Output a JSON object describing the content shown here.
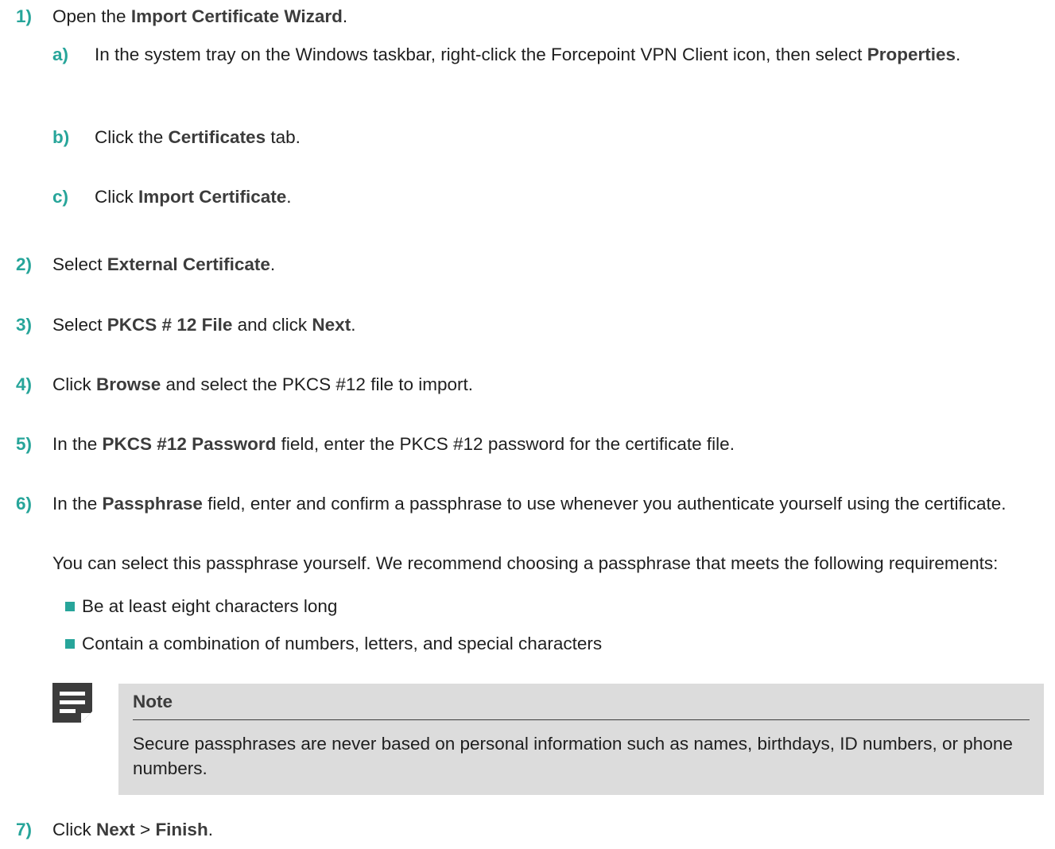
{
  "steps": [
    {
      "num": "1)",
      "parts": [
        "Open the ",
        "Import Certificate Wizard",
        "."
      ]
    },
    {
      "num": "2)",
      "parts": [
        "Select ",
        "External Certificate",
        "."
      ]
    },
    {
      "num": "3)",
      "parts": [
        "Select ",
        "PKCS # 12 File",
        " and click ",
        "Next",
        "."
      ]
    },
    {
      "num": "4)",
      "parts": [
        "Click ",
        "Browse",
        " and select the PKCS #12 file to import."
      ]
    },
    {
      "num": "5)",
      "parts": [
        "In the ",
        "PKCS #12 Password",
        " field, enter the PKCS #12 password for the certificate file."
      ]
    },
    {
      "num": "6)",
      "parts": [
        "In the ",
        "Passphrase",
        " field, enter and confirm a passphrase to use whenever you authenticate yourself using the certificate."
      ]
    },
    {
      "num": "7)",
      "parts": [
        "Click ",
        "Next",
        " > ",
        "Finish",
        "."
      ]
    }
  ],
  "substeps": [
    {
      "num": "a)",
      "parts": [
        "In the system tray on the Windows taskbar, right-click the Forcepoint VPN Client icon, then select ",
        "Properties",
        "."
      ]
    },
    {
      "num": "b)",
      "parts": [
        "Click the ",
        "Certificates",
        " tab."
      ]
    },
    {
      "num": "c)",
      "parts": [
        "Click ",
        "Import Certificate",
        "."
      ]
    }
  ],
  "step6_para": "You can select this passphrase yourself. We recommend choosing a passphrase that meets the following requirements:",
  "bullets": [
    "Be at least eight characters long",
    "Contain a combination of numbers, letters, and special characters"
  ],
  "note": {
    "icon": "note-icon",
    "title": "Note",
    "body": "Secure passphrases are never based on personal information such as names, birthdays, ID numbers, or phone numbers."
  },
  "colors": {
    "accent": "#27a59a",
    "note_bg": "#dcdcdc"
  }
}
